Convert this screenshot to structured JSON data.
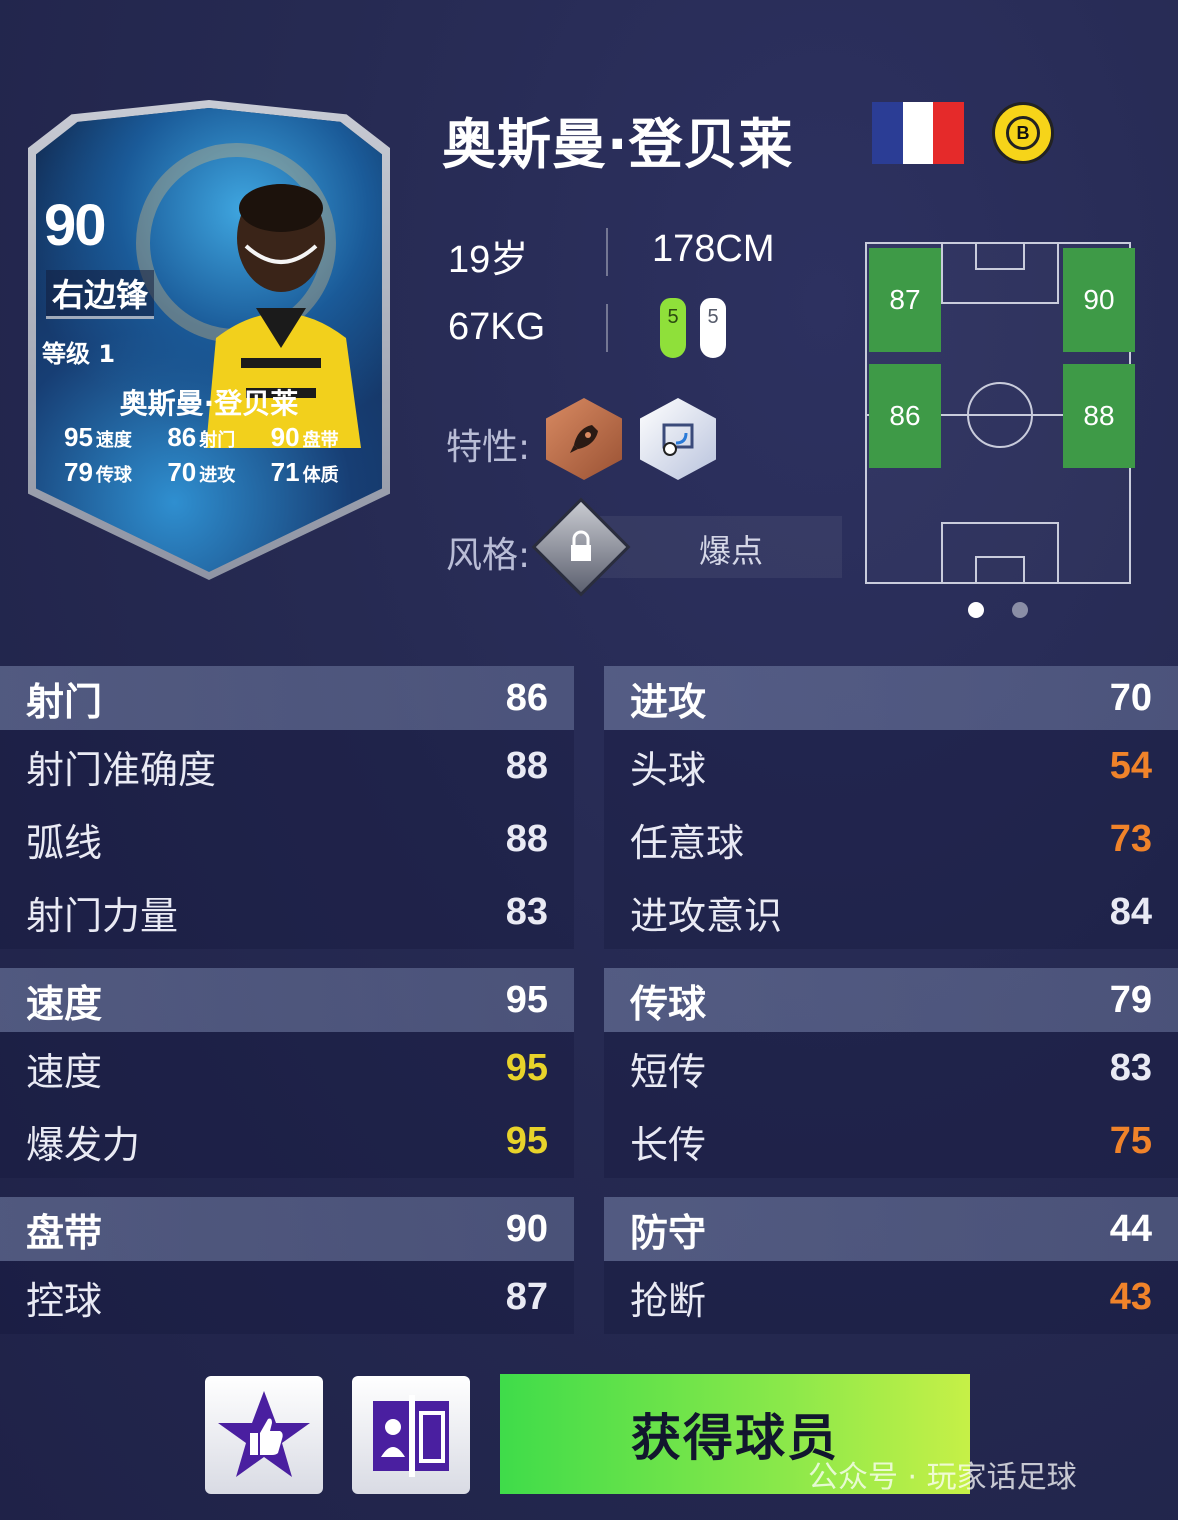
{
  "card": {
    "rating": "90",
    "position": "右边锋",
    "level": "等级 1",
    "name": "奥斯曼·登贝莱",
    "stats": [
      {
        "value": "95",
        "label": "速度"
      },
      {
        "value": "86",
        "label": "射门"
      },
      {
        "value": "90",
        "label": "盘带"
      },
      {
        "value": "79",
        "label": "传球"
      },
      {
        "value": "70",
        "label": "进攻"
      },
      {
        "value": "71",
        "label": "体质"
      }
    ]
  },
  "player": {
    "name": "奥斯曼·登贝莱",
    "age": "19岁",
    "height": "178CM",
    "weight": "67KG",
    "foot_left": "5",
    "foot_right": "5",
    "club_badge_letter": "B"
  },
  "traits_label": "特性:",
  "style_label": "风格:",
  "style_value": "爆点",
  "pitch_zones": [
    "87",
    "90",
    "86",
    "88"
  ],
  "pager": {
    "active": 0,
    "count": 2
  },
  "colors": {
    "zone_green": "#3e9a47",
    "stat_orange": "#f0832a",
    "stat_yellow": "#e8d32a",
    "cta_green": "#5ee24a"
  },
  "stat_groups_left": [
    {
      "title": "射门",
      "value": "86",
      "rows": [
        {
          "label": "射门准确度",
          "value": "88",
          "tone": "normal"
        },
        {
          "label": "弧线",
          "value": "88",
          "tone": "normal"
        },
        {
          "label": "射门力量",
          "value": "83",
          "tone": "normal"
        }
      ]
    },
    {
      "title": "速度",
      "value": "95",
      "rows": [
        {
          "label": "速度",
          "value": "95",
          "tone": "yellow"
        },
        {
          "label": "爆发力",
          "value": "95",
          "tone": "yellow"
        }
      ]
    },
    {
      "title": "盘带",
      "value": "90",
      "rows": [
        {
          "label": "控球",
          "value": "87",
          "tone": "normal"
        }
      ]
    }
  ],
  "stat_groups_right": [
    {
      "title": "进攻",
      "value": "70",
      "rows": [
        {
          "label": "头球",
          "value": "54",
          "tone": "orange"
        },
        {
          "label": "任意球",
          "value": "73",
          "tone": "orange"
        },
        {
          "label": "进攻意识",
          "value": "84",
          "tone": "normal"
        }
      ]
    },
    {
      "title": "传球",
      "value": "79",
      "rows": [
        {
          "label": "短传",
          "value": "83",
          "tone": "normal"
        },
        {
          "label": "长传",
          "value": "75",
          "tone": "orange"
        }
      ]
    },
    {
      "title": "防守",
      "value": "44",
      "rows": [
        {
          "label": "抢断",
          "value": "43",
          "tone": "orange"
        }
      ]
    }
  ],
  "buttons": {
    "like_icon": "thumbs-up-star-icon",
    "compare_icon": "compare-players-icon",
    "get_player": "获得球员"
  },
  "watermark": "公众号 · 玩家话足球"
}
